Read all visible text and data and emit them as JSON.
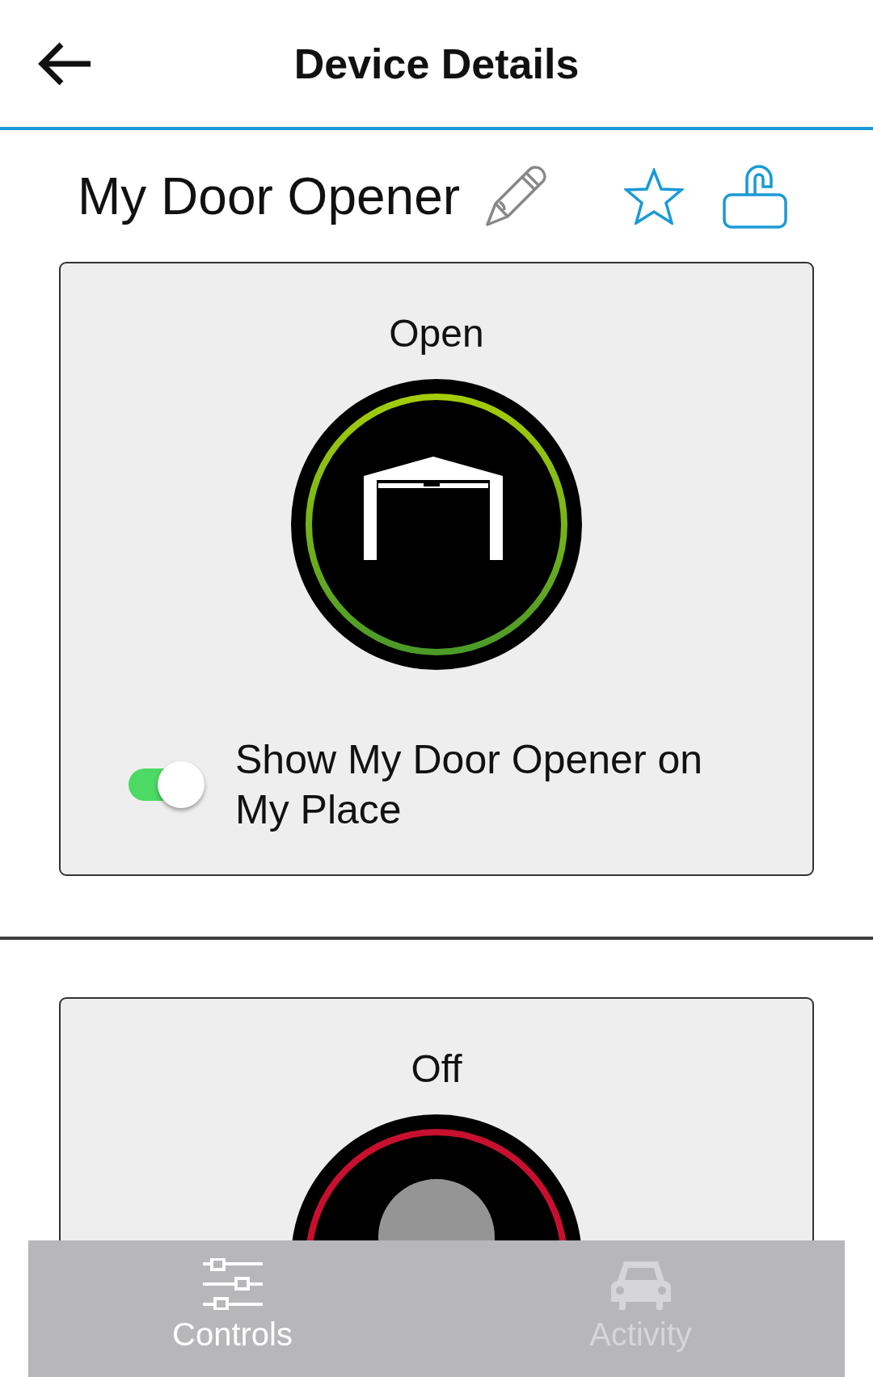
{
  "header": {
    "title": "Device Details"
  },
  "device": {
    "name": "My Door Opener",
    "favorite": false
  },
  "controls": [
    {
      "kind": "garage-door",
      "status": "Open",
      "on": true,
      "show_on_my_place": {
        "label": "Show My Door Opener on My Place",
        "on": true
      }
    },
    {
      "kind": "light",
      "status": "Off",
      "on": false
    }
  ],
  "tabs": [
    {
      "label": "Controls",
      "selected": true
    },
    {
      "label": "Activity",
      "selected": false
    }
  ]
}
